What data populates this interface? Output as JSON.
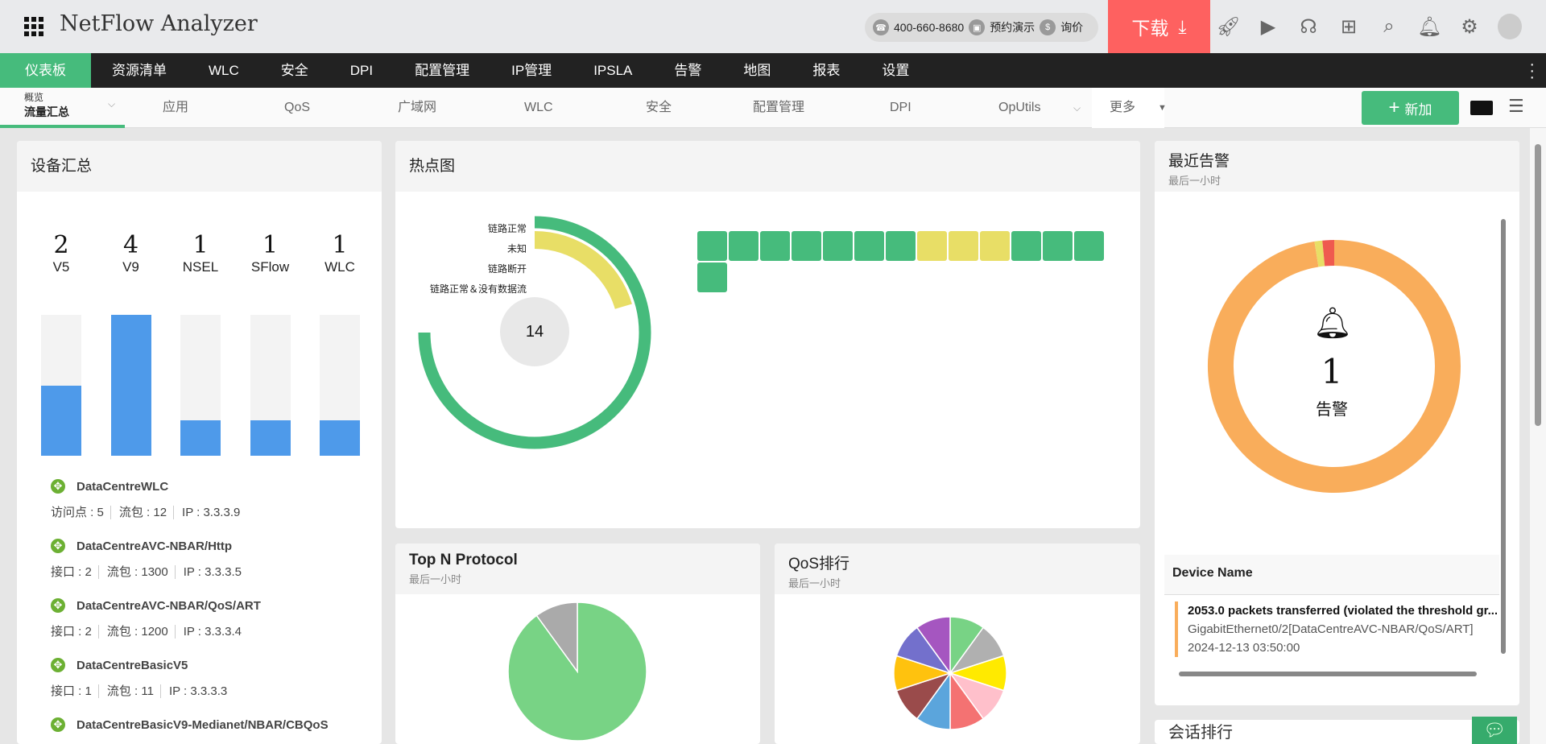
{
  "header": {
    "title": "NetFlow Analyzer",
    "phone": "400-660-8680",
    "demo": "预约演示",
    "price": "询价",
    "download": "下载"
  },
  "nav": [
    "仪表板",
    "资源清单",
    "WLC",
    "安全",
    "DPI",
    "配置管理",
    "IP管理",
    "IPSLA",
    "告警",
    "地图",
    "报表",
    "设置"
  ],
  "subnav": {
    "active_top": "概览",
    "active": "流量汇总",
    "tabs": [
      "应用",
      "QoS",
      "广域网",
      "WLC",
      "安全",
      "配置管理",
      "DPI",
      "OpUtils"
    ],
    "more": "更多",
    "add": "新加"
  },
  "device_summary": {
    "title": "设备汇总",
    "counts": [
      {
        "label": "V5",
        "value": 2
      },
      {
        "label": "V9",
        "value": 4
      },
      {
        "label": "NSEL",
        "value": 1
      },
      {
        "label": "SFlow",
        "value": 1
      },
      {
        "label": "WLC",
        "value": 1
      }
    ],
    "max": 4,
    "devices": [
      {
        "name": "DataCentreWLC",
        "meta": [
          "访问点 : 5",
          "流包 : 12",
          "IP : 3.3.3.9"
        ]
      },
      {
        "name": "DataCentreAVC-NBAR/Http",
        "meta": [
          "接口 : 2",
          "流包 : 1300",
          "IP : 3.3.3.5"
        ]
      },
      {
        "name": "DataCentreAVC-NBAR/QoS/ART",
        "meta": [
          "接口 : 2",
          "流包 : 1200",
          "IP : 3.3.3.4"
        ]
      },
      {
        "name": "DataCentreBasicV5",
        "meta": [
          "接口 : 1",
          "流包 : 11",
          "IP : 3.3.3.3"
        ]
      },
      {
        "name": "DataCentreBasicV9-Medianet/NBAR/CBQoS",
        "meta": []
      }
    ]
  },
  "heatmap": {
    "title": "热点图",
    "total": "14",
    "legend": [
      "链路正常",
      "未知",
      "链路断开",
      "链路正常＆没有数据流"
    ],
    "normal": 11,
    "unknown": 3,
    "cells": [
      "g",
      "g",
      "g",
      "g",
      "g",
      "g",
      "g",
      "y",
      "y",
      "y",
      "g",
      "g",
      "g",
      "g"
    ],
    "colors": {
      "g": "#46bb7c",
      "y": "#e8de66"
    }
  },
  "topn": {
    "title": "Top N Protocol",
    "subtitle": "最后一小时",
    "slices": [
      90,
      10
    ],
    "colors": [
      "#78d385",
      "#aaaaaa"
    ]
  },
  "qos": {
    "title": "QoS排行",
    "subtitle": "最后一小时",
    "slices": [
      1,
      1,
      1,
      1,
      1,
      1,
      1,
      1,
      1,
      1
    ],
    "colors": [
      "#78d385",
      "#b0b0b0",
      "#ffea00",
      "#ffc0cb",
      "#f47272",
      "#5ba5dc",
      "#9a4b4b",
      "#ffc20e",
      "#7370cc",
      "#a556c0"
    ]
  },
  "alerts": {
    "title": "最近告警",
    "subtitle": "最后一小时",
    "count": "1",
    "label": "告警",
    "column": "Device Name",
    "slices": [
      97.5,
      1,
      1.5
    ],
    "colors": [
      "#f9ad5b",
      "#e8de66",
      "#ef5a4f"
    ],
    "item": {
      "msg": "2053.0 packets transferred (violated the threshold gr...",
      "src": "GigabitEthernet0/2[DataCentreAVC-NBAR/QoS/ART]",
      "time": "2024-12-13 03:50:00"
    }
  },
  "conversations": {
    "title": "会话排行"
  }
}
